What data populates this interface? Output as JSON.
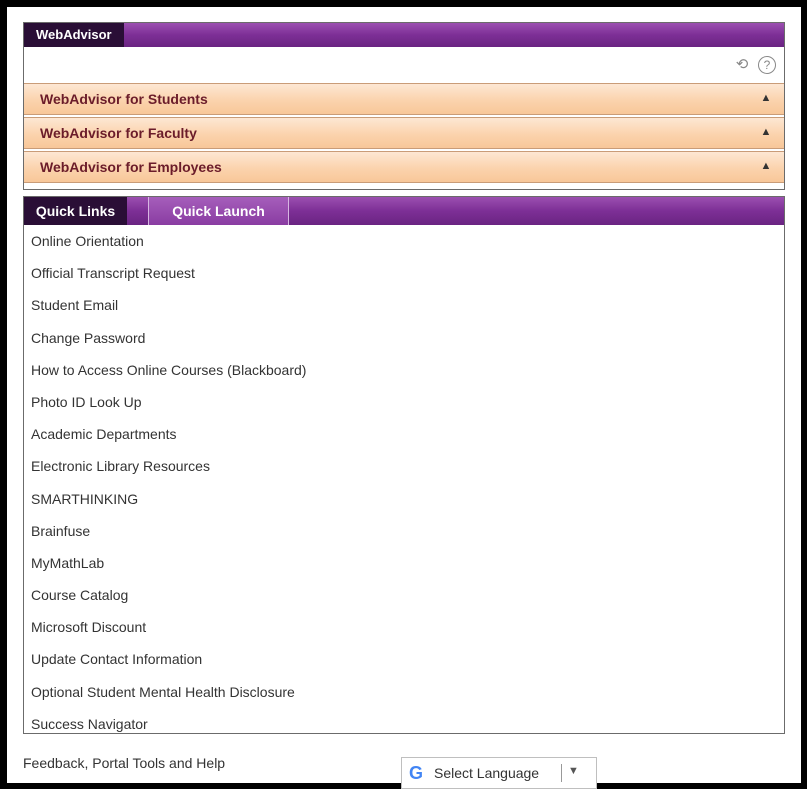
{
  "webadvisor": {
    "tab_label": "WebAdvisor",
    "icons": [
      "refresh-icon",
      "help-icon"
    ],
    "sections": [
      {
        "label": "WebAdvisor for Students",
        "icon": "chevron-up-icon"
      },
      {
        "label": "WebAdvisor for Faculty",
        "icon": "chevron-up-icon"
      },
      {
        "label": "WebAdvisor for Employees",
        "icon": "chevron-up-icon"
      }
    ]
  },
  "quicklinks": {
    "tabs": [
      {
        "label": "Quick Links",
        "active": true
      },
      {
        "label": "Quick Launch",
        "active": false
      }
    ],
    "links": [
      "Online Orientation",
      "Official Transcript Request",
      "Student Email",
      "Change Password",
      "How to Access Online Courses (Blackboard)",
      "Photo ID Look Up",
      "Academic Departments",
      "Electronic Library Resources",
      "SMARTHINKING",
      "Brainfuse",
      "MyMathLab",
      "Course Catalog",
      "Microsoft Discount",
      "Update Contact Information",
      "Optional Student Mental Health Disclosure",
      "Success Navigator"
    ]
  },
  "footer": {
    "link": "Feedback, Portal Tools and Help",
    "language_select": "Select Language",
    "language_icon": "google-g-icon"
  },
  "colors": {
    "tab_purple": "#7d2f96",
    "active_tab": "#2a0e36",
    "accordion_peach": "#fbd3ad",
    "accordion_text": "#6b1c2a"
  }
}
